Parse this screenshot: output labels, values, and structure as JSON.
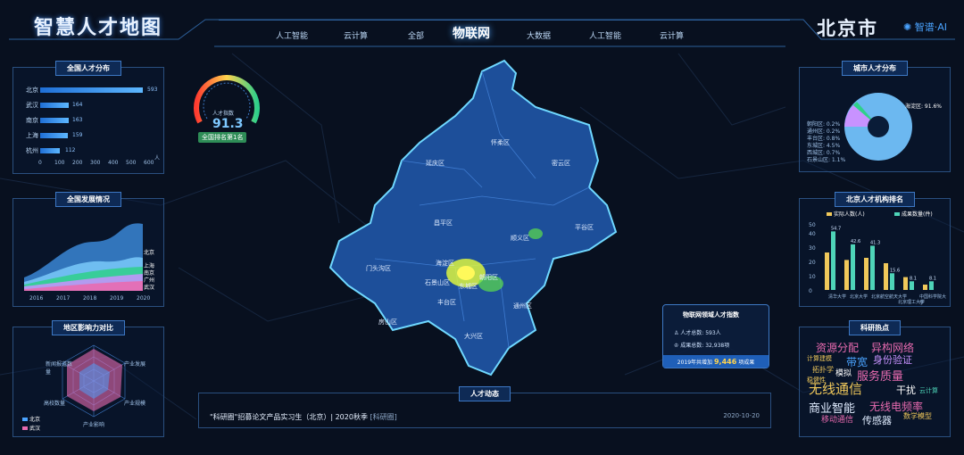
{
  "header": {
    "title": "智慧人才地图",
    "city": "北京市",
    "brand": "智谱·AI",
    "nav": [
      "人工智能",
      "云计算",
      "全部",
      "物联网",
      "大数据",
      "人工智能",
      "云计算"
    ],
    "nav_active": "物联网"
  },
  "national_talent": {
    "title": "全国人才分布",
    "rows": [
      {
        "city": "北京",
        "value": 593
      },
      {
        "city": "武汉",
        "value": 164
      },
      {
        "city": "南京",
        "value": 163
      },
      {
        "city": "上海",
        "value": 159
      },
      {
        "city": "杭州",
        "value": 112
      }
    ],
    "axis": [
      "0",
      "100",
      "200",
      "300",
      "400",
      "500",
      "600"
    ],
    "unit": "人"
  },
  "development": {
    "title": "全国发展情况",
    "years": [
      "2016",
      "2017",
      "2018",
      "2019",
      "2020"
    ],
    "series_labels": [
      "北京",
      "上海",
      "南京",
      "广州",
      "武汉"
    ]
  },
  "influence": {
    "title": "地区影响力对比",
    "axes": [
      "新闻报道数量",
      "产业发展",
      "产业规模",
      "产业影响",
      "高校数量",
      "科研成果"
    ],
    "legend": [
      "北京",
      "武汉"
    ]
  },
  "gauge": {
    "label": "人才指数",
    "value": "91.3",
    "badge": "全国排名第1名",
    "level": 0.913
  },
  "map": {
    "districts": [
      "延庆区",
      "怀柔区",
      "密云区",
      "昌平区",
      "顺义区",
      "平谷区",
      "门头沟区",
      "海淀区",
      "朝阳区",
      "石景山区",
      "东城区",
      "西城区",
      "丰台区",
      "通州区",
      "房山区",
      "大兴区"
    ]
  },
  "info_box": {
    "title": "物联网领域人才指数",
    "talent_total": "人才总数: 593人",
    "result_total": "成果总数: 32,938项",
    "foot_prefix": "2019年共增加",
    "foot_value": "9,446",
    "foot_suffix": "项成果"
  },
  "news": {
    "title": "人才动态",
    "text": "\"科研圈\"招募论文产品实习生（北京）| 2020秋季",
    "source": "[科研圈]",
    "date": "2020-10-20"
  },
  "city_talent": {
    "title": "城市人才分布",
    "main_label": "海淀区: 91.6%",
    "labels": [
      "朝阳区: 0.2%",
      "通州区: 0.2%",
      "丰台区: 0.8%",
      "东城区: 4.5%",
      "西城区: 0.7%",
      "东城区: 0.7%",
      "石景山区: 1.1%"
    ]
  },
  "institutions": {
    "title": "北京人才机构排名",
    "legend": [
      "实际人数(人)",
      "成果数量(件)"
    ],
    "axis": [
      "0",
      "10",
      "20",
      "30",
      "40",
      "50",
      "60"
    ],
    "values_a": [
      35,
      28,
      30,
      25,
      12,
      5
    ],
    "values_b": [
      54.7,
      42.6,
      41.3,
      15.6,
      8.1,
      8.1
    ],
    "labels_a": [
      "54.7",
      "42.6",
      "40",
      "31.3",
      "15.6",
      "5",
      "8.1"
    ],
    "categories": [
      "清华大学",
      "北京大学",
      "北京航空航天大学",
      "北京理工大学",
      "中国科学院大学"
    ],
    "colors": [
      "#f0c85a",
      "#4ed4b8"
    ]
  },
  "hot": {
    "title": "科研热点",
    "words": [
      {
        "t": "资源分配",
        "c": "#e86bb0",
        "s": 12
      },
      {
        "t": "异构网络",
        "c": "#e86bb0",
        "s": 12
      },
      {
        "t": "计算建模",
        "c": "#f0c85a",
        "s": 7
      },
      {
        "t": "带宽",
        "c": "#4aa3ff",
        "s": 12
      },
      {
        "t": "身份验证",
        "c": "#c892ff",
        "s": 11
      },
      {
        "t": "服务质量",
        "c": "#e86bb0",
        "s": 13
      },
      {
        "t": "拓扑学",
        "c": "#f0c85a",
        "s": 8
      },
      {
        "t": "模拟",
        "c": "#fff",
        "s": 9
      },
      {
        "t": "无线通信",
        "c": "#f0c85a",
        "s": 15
      },
      {
        "t": "干扰",
        "c": "#fff",
        "s": 11
      },
      {
        "t": "商业智能",
        "c": "#e0ecff",
        "s": 13
      },
      {
        "t": "无线电频率",
        "c": "#e86bb0",
        "s": 12
      },
      {
        "t": "移动通信",
        "c": "#e86bb0",
        "s": 9
      },
      {
        "t": "传感器",
        "c": "#e0ecff",
        "s": 11
      },
      {
        "t": "数学模型",
        "c": "#f0c85a",
        "s": 8
      },
      {
        "t": "稳健性",
        "c": "#f0c85a",
        "s": 7
      },
      {
        "t": "云计算",
        "c": "#4ed4b8",
        "s": 7
      }
    ]
  }
}
